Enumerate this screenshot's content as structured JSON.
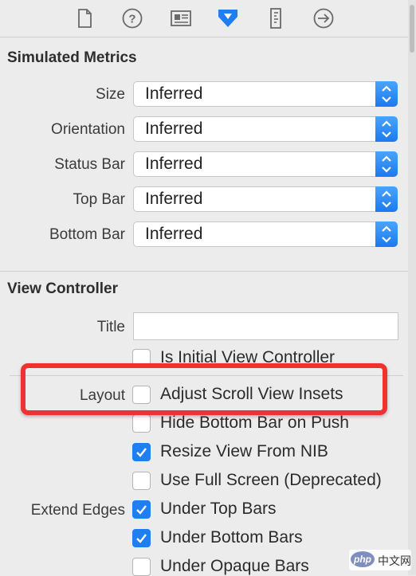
{
  "toolbar": {
    "icons": [
      {
        "name": "file-inspector-icon"
      },
      {
        "name": "quick-help-icon"
      },
      {
        "name": "identity-inspector-icon"
      },
      {
        "name": "attributes-inspector-icon",
        "selected": true
      },
      {
        "name": "size-inspector-icon"
      },
      {
        "name": "connections-inspector-icon"
      }
    ],
    "accent_color": "#1f7ef2"
  },
  "simulated_metrics": {
    "title": "Simulated Metrics",
    "rows": [
      {
        "label": "Size",
        "value": "Inferred"
      },
      {
        "label": "Orientation",
        "value": "Inferred"
      },
      {
        "label": "Status Bar",
        "value": "Inferred"
      },
      {
        "label": "Top Bar",
        "value": "Inferred"
      },
      {
        "label": "Bottom Bar",
        "value": "Inferred"
      }
    ]
  },
  "view_controller": {
    "title": "View Controller",
    "title_label": "Title",
    "title_value": "",
    "is_initial": {
      "label": "Is Initial View Controller",
      "checked": false
    },
    "layout_label": "Layout",
    "adjust_scroll": {
      "label": "Adjust Scroll View Insets",
      "checked": false
    },
    "hide_bottom_bar": {
      "label": "Hide Bottom Bar on Push",
      "checked": false
    },
    "resize_nib": {
      "label": "Resize View From NIB",
      "checked": true
    },
    "full_screen": {
      "label": "Use Full Screen (Deprecated)",
      "checked": false
    },
    "extend_edges_label": "Extend Edges",
    "under_top": {
      "label": "Under Top Bars",
      "checked": true
    },
    "under_bottom": {
      "label": "Under Bottom Bars",
      "checked": true
    },
    "under_opaque": {
      "label": "Under Opaque Bars",
      "checked": false
    }
  },
  "annotation": {
    "color": "#ef3131"
  },
  "watermark": {
    "logo_text": "php",
    "text": "中文网"
  }
}
